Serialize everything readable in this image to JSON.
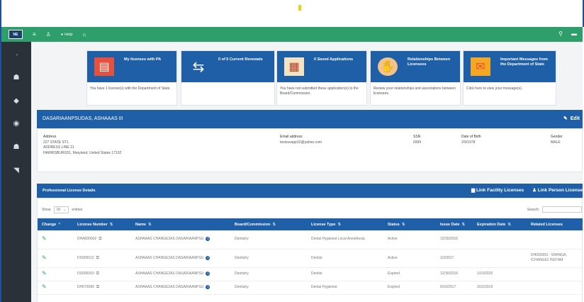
{
  "colors": {
    "topbar": "#2e9e6b",
    "sidebar": "#2b3138",
    "accent_blue": "#1f5fa8",
    "edit_green": "#2e9e6b"
  },
  "topbar": {
    "logo": "NE",
    "help_label": "Help"
  },
  "tiles": [
    {
      "icon": "license-card-icon",
      "title": "My licenses with PA",
      "body": "You have 1 license(s) with the Department of State."
    },
    {
      "icon": "renewal-arrows-icon",
      "title": "0 of 5 Current Renewals",
      "body": ""
    },
    {
      "icon": "calendar-icon",
      "title": "0 Saved Applications",
      "body": "You have not submitted these application(s) to the Board/Commission."
    },
    {
      "icon": "handshake-icon",
      "title": "Relationships Between Licensees",
      "body": "Review your relationships and associations between licensees."
    },
    {
      "icon": "envelope-icon",
      "title": "Important Messages from the Department of State",
      "body": "Click here to view your message(s)."
    }
  ],
  "profile": {
    "name": "DASARIAANPSUDAS, ASHAAAS III",
    "edit_label": "Edit",
    "address_label": "Address",
    "address_lines": [
      "227 STATE ST1",
      "ADDRESS LINE 21",
      "HARRISBURG51, Maryland, United States 17102"
    ],
    "email_label": "Email address",
    "email": "testsssapp10@yahoo.com",
    "ssn_label": "SSN",
    "ssn": "6999",
    "dob_label": "Date of Birth",
    "dob": "2/9/1978",
    "gender_label": "Gender",
    "gender": "MALE"
  },
  "licenses": {
    "title": "Professional License Details",
    "link_facility": "Link Facility Licenses",
    "link_person": "Link Person License",
    "show_label": "Show",
    "show_value": "10",
    "entries_label": "entries",
    "search_label": "Search:",
    "headers": [
      "Change",
      "License Number",
      "Name",
      "Board/Commission",
      "License Type",
      "Status",
      "Issue Date",
      "Expiration Date",
      "Related Licenses"
    ],
    "rows": [
      {
        "number": "DHA000002",
        "name": "ASHAAAS CHANGE2AS DASARIAANPSU",
        "board": "Dentistry",
        "type": "Dental Hygienist Local Anesthesia",
        "status": "Active",
        "issue": "12/30/2016",
        "expiration": "",
        "related": ""
      },
      {
        "number": "DS000012",
        "name": "ASHAAAS CHANGE2AS DASARIAANPSU",
        "board": "Dentistry",
        "type": "Dentist",
        "status": "Active",
        "issue": "1/3/2017",
        "expiration": "",
        "related": "DH000003 - SHANGA, ICHANGE2 INSTAM"
      },
      {
        "number": "DS000003",
        "name": "ASHAAAS CHANGE2AS DASARIAANPSU",
        "board": "Dentistry",
        "type": "Dentist",
        "status": "Expired",
        "issue": "12/30/2016",
        "expiration": "1/10/2020",
        "related": ""
      },
      {
        "number": "DH073090",
        "name": "ASHAAAS CHANGE2AS DASARIAANPSU",
        "board": "Dentistry",
        "type": "Dental Hygienist",
        "status": "Expired",
        "issue": "6/16/2017",
        "expiration": "3/31/2019",
        "related": ""
      }
    ]
  }
}
